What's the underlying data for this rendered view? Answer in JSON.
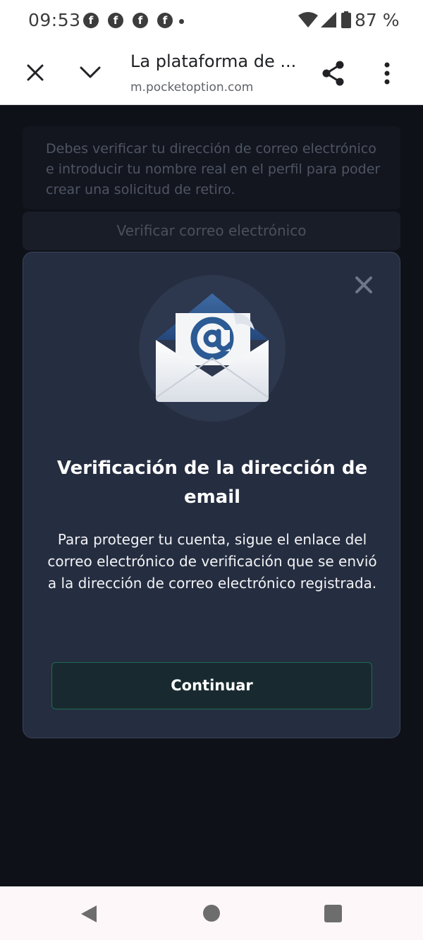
{
  "status_bar": {
    "time": "09:53",
    "notification_icons": [
      "facebook-icon",
      "facebook-icon",
      "facebook-icon",
      "facebook-icon"
    ],
    "battery_percent": "87 %"
  },
  "browser": {
    "page_title": "La plataforma de ...",
    "url": "m.pocketoption.com"
  },
  "page": {
    "notice_text": "Debes verificar tu dirección de correo electrónico e introducir tu nombre real en el perfil para poder crear una solicitud de retiro.",
    "verify_button_label": "Verificar correo electrónico"
  },
  "modal": {
    "title": "Verificación de la dirección de email",
    "description": "Para proteger tu cuenta, sigue el enlace del correo electrónico de verificación que se envió a la dirección de correo electrónico registrada.",
    "continue_label": "Continuar",
    "illustration_icon": "email-envelope-icon"
  },
  "colors": {
    "page_bg": "#0f1119",
    "modal_bg": "#252d40",
    "button_border": "#1f6a55"
  }
}
